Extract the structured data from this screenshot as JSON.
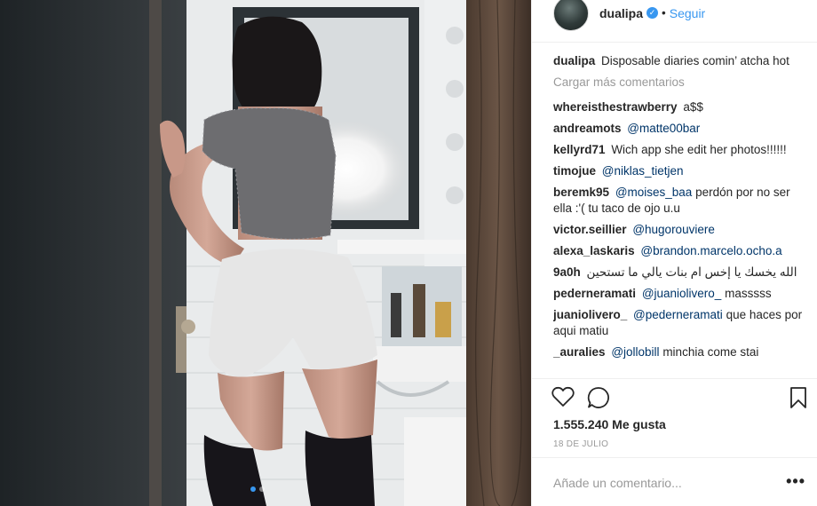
{
  "post": {
    "username": "dualipa",
    "verified": true,
    "separator": "•",
    "follow_label": "Seguir"
  },
  "caption": {
    "user": "dualipa",
    "text": "Disposable diaries comin’ atcha hot"
  },
  "load_more_label": "Cargar más comentarios",
  "comments": [
    {
      "user": "whereisthestrawberry",
      "mention": "",
      "text": "a$$"
    },
    {
      "user": "andreamots",
      "mention": "@matte00bar",
      "text": ""
    },
    {
      "user": "kellyrd71",
      "mention": "",
      "text": "Wich app she edit her photos!!!!!!"
    },
    {
      "user": "timojue",
      "mention": "@niklas_tietjen",
      "text": ""
    },
    {
      "user": "beremk95",
      "mention": "@moises_baa",
      "text": "perdón por no ser ella :'( tu taco de ojo u.u"
    },
    {
      "user": "victor.seillier",
      "mention": "@hugorouviere",
      "text": ""
    },
    {
      "user": "alexa_laskaris",
      "mention": "@brandon.marcelo.ocho.a",
      "text": ""
    },
    {
      "user": "9a0h",
      "mention": "",
      "text": "الله يخسك يا إخس ام بنات يالي ما تستحين"
    },
    {
      "user": "pederneramati",
      "mention": "@juaniolivero_",
      "text": "masssss"
    },
    {
      "user": "juaniolivero_",
      "mention": "@pederneramati",
      "text": "que haces por aqui matiu"
    },
    {
      "user": "_auralies",
      "mention": "@jollobill",
      "text": "minchia come stai"
    }
  ],
  "likes": "1.555.240 Me gusta",
  "date": "18 DE JULIO",
  "add_comment": {
    "placeholder": "Añade un comentario..."
  },
  "more_options": "•••",
  "icons": {
    "like": "heart-icon",
    "comment": "speech-bubble-icon",
    "save": "bookmark-icon",
    "verified": "verified-badge-icon"
  },
  "colors": {
    "link": "#3897f0",
    "mention": "#003569",
    "muted": "#999999",
    "text": "#262626"
  }
}
